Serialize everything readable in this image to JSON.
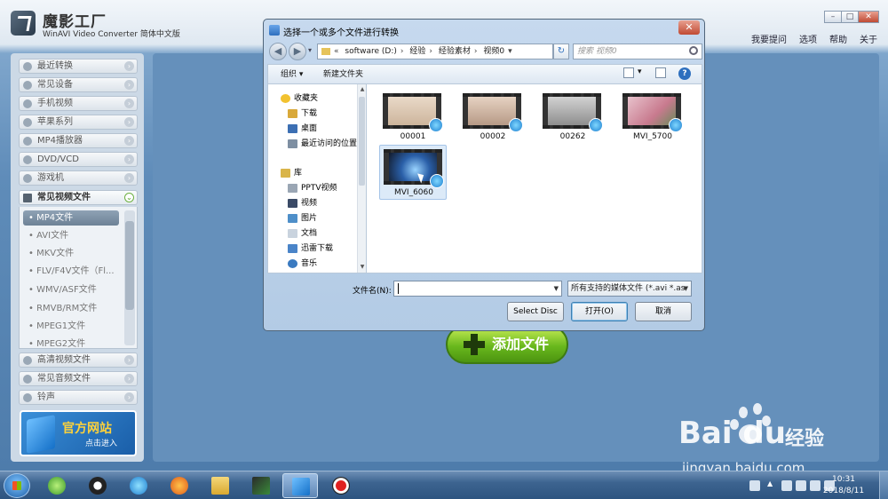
{
  "app": {
    "title": "魔影工厂",
    "subtitle": "WinAVI Video Converter 简体中文版",
    "top_links": [
      "我要提问",
      "选项",
      "帮助",
      "关于"
    ],
    "categories_top": [
      "最近转换",
      "常见设备",
      "手机视频",
      "苹果系列",
      "MP4播放器",
      "DVD/VCD",
      "游戏机"
    ],
    "open_category": "常见视频文件",
    "sub_items": [
      "MP4文件",
      "AVI文件",
      "MKV文件",
      "FLV/F4V文件（Fl...",
      "WMV/ASF文件",
      "RMVB/RM文件",
      "MPEG1文件",
      "MPEG2文件"
    ],
    "active_sub_index": 0,
    "categories_bottom": [
      "高清视频文件",
      "常见音频文件",
      "铃声"
    ],
    "promo_title": "官方网站",
    "promo_sub": "点击进入",
    "add_button": "添加文件"
  },
  "dialog": {
    "title": "选择一个或多个文件进行转换",
    "close": "✕",
    "path": [
      "software (D:)",
      "经验",
      "经验素材",
      "视频0"
    ],
    "path_prefix": "«",
    "search_placeholder": "搜索 视频0",
    "toolbar": {
      "organize": "组织 ▾",
      "new_folder": "新建文件夹",
      "help": "?"
    },
    "nav": {
      "favorites": "收藏夹",
      "favorites_items": [
        "下载",
        "桌面",
        "最近访问的位置"
      ],
      "library": "库",
      "library_items": [
        "PPTV视频",
        "视频",
        "图片",
        "文档",
        "迅雷下载",
        "音乐"
      ]
    },
    "files": [
      {
        "name": "00001"
      },
      {
        "name": "00002"
      },
      {
        "name": "00262"
      },
      {
        "name": "MVI_5700"
      },
      {
        "name": "MVI_6060"
      }
    ],
    "selected_file_index": 4,
    "filename_label": "文件名(N):",
    "filename_value": "",
    "filetype": "所有支持的媒体文件 (*.avi *.as",
    "buttons": {
      "select_disc": "Select Disc",
      "open": "打开(O)",
      "cancel": "取消"
    }
  },
  "taskbar": {
    "time": "10:31",
    "date": "2018/8/11"
  },
  "watermark": {
    "brand": "Bai  du",
    "suffix": "经验",
    "url": "jingyan.baidu.com"
  },
  "colors": {
    "accent": "#2e6fbe",
    "add_button": "#69b81d",
    "promo_title": "#ffd23a"
  }
}
